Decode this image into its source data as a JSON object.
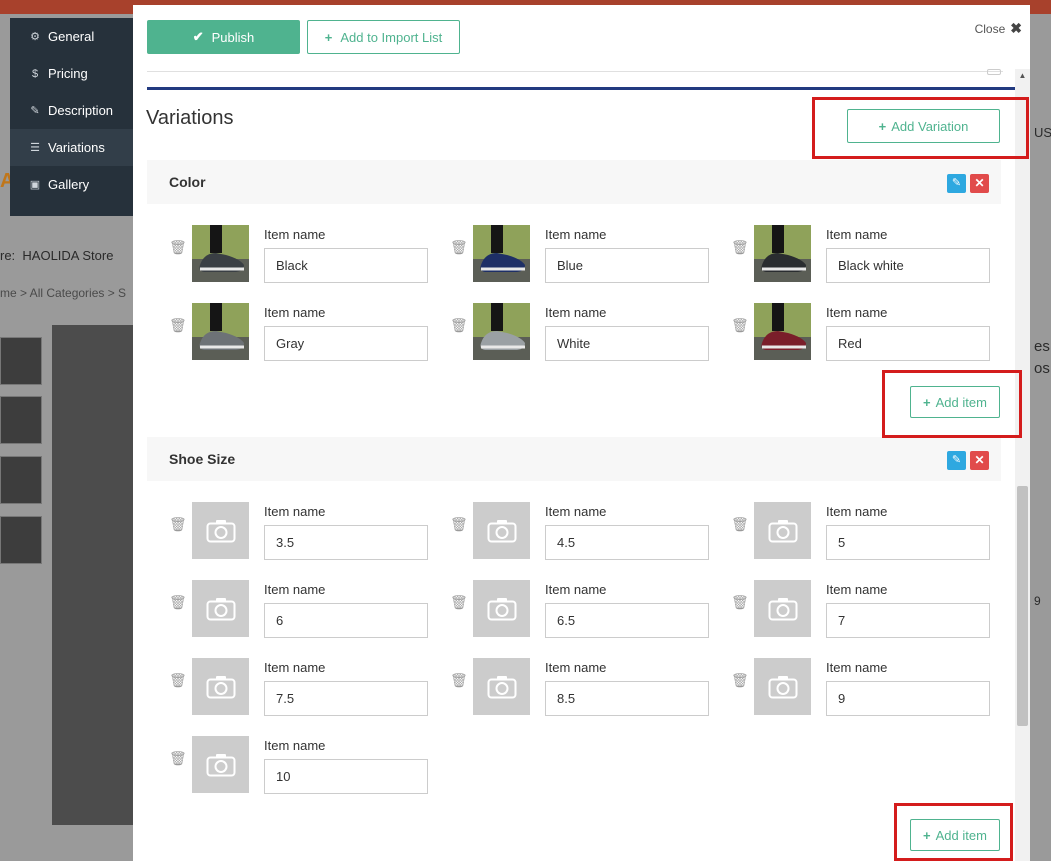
{
  "background": {
    "store_prefix": "re:",
    "store_name": "HAOLIDA Store",
    "breadcrumb": "me > All Categories > S",
    "right_fragments": [
      "US",
      "es",
      "os",
      "9"
    ]
  },
  "sidebar": {
    "items": [
      {
        "label": "General",
        "icon": "gear-icon",
        "glyph": "⚙"
      },
      {
        "label": "Pricing",
        "icon": "dollar-icon",
        "glyph": "$"
      },
      {
        "label": "Description",
        "icon": "pencil-icon",
        "glyph": "✎"
      },
      {
        "label": "Variations",
        "icon": "list-icon",
        "glyph": "☰"
      },
      {
        "label": "Gallery",
        "icon": "image-icon",
        "glyph": "▣"
      }
    ],
    "active": "Variations"
  },
  "modal": {
    "publish_label": "Publish",
    "import_label": "Add to Import List",
    "close_label": "Close",
    "section_title": "Variations",
    "add_variation_label": "Add Variation"
  },
  "variations": [
    {
      "title": "Color",
      "add_item_label": "Add item",
      "items": [
        {
          "label": "Item name",
          "value": "Black",
          "image": "photo",
          "shoe_color": "#3a3f44"
        },
        {
          "label": "Item name",
          "value": "Blue",
          "image": "photo",
          "shoe_color": "#1e2f66"
        },
        {
          "label": "Item name",
          "value": "Black white",
          "image": "photo",
          "shoe_color": "#2a2d30"
        },
        {
          "label": "Item name",
          "value": "Gray",
          "image": "photo",
          "shoe_color": "#6d7276"
        },
        {
          "label": "Item name",
          "value": "White",
          "image": "photo",
          "shoe_color": "#9aa0a4"
        },
        {
          "label": "Item name",
          "value": "Red",
          "image": "photo",
          "shoe_color": "#7a1e2a"
        }
      ]
    },
    {
      "title": "Shoe Size",
      "add_item_label": "Add item",
      "items": [
        {
          "label": "Item name",
          "value": "3.5",
          "image": "camera"
        },
        {
          "label": "Item name",
          "value": "4.5",
          "image": "camera"
        },
        {
          "label": "Item name",
          "value": "5",
          "image": "camera"
        },
        {
          "label": "Item name",
          "value": "6",
          "image": "camera"
        },
        {
          "label": "Item name",
          "value": "6.5",
          "image": "camera"
        },
        {
          "label": "Item name",
          "value": "7",
          "image": "camera"
        },
        {
          "label": "Item name",
          "value": "7.5",
          "image": "camera"
        },
        {
          "label": "Item name",
          "value": "8.5",
          "image": "camera"
        },
        {
          "label": "Item name",
          "value": "9",
          "image": "camera"
        },
        {
          "label": "Item name",
          "value": "10",
          "image": "camera"
        }
      ]
    }
  ],
  "colors": {
    "accent": "#4fb38f",
    "sidebar_bg": "#26313b",
    "edit_blue": "#2ea8e0",
    "delete_red": "#e14b4b",
    "annotation_red": "#d41c1c"
  }
}
